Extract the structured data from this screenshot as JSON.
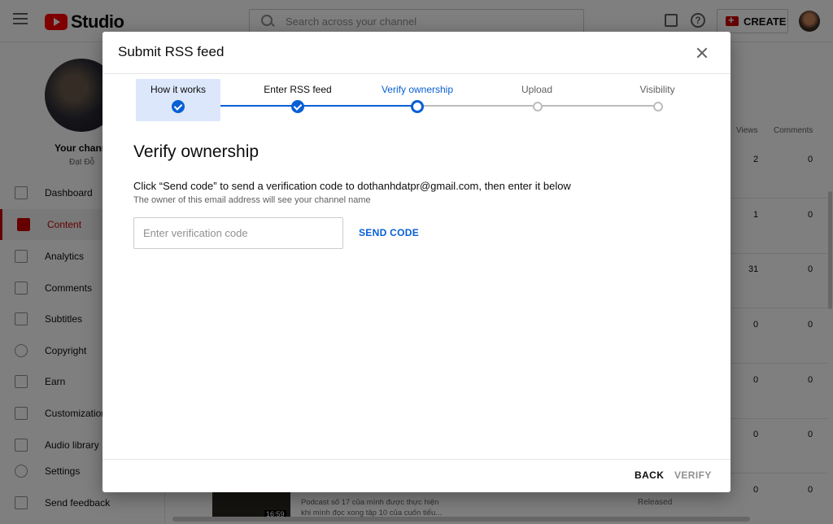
{
  "app": {
    "logo_text": "Studio"
  },
  "search": {
    "placeholder": "Search across your channel"
  },
  "header": {
    "create_label": "CREATE",
    "help_glyph": "?"
  },
  "sidebar": {
    "channel_label": "Your channel",
    "channel_name": "Đạt Đỗ",
    "items": [
      {
        "label": "Dashboard",
        "icon": "dashboard-icon"
      },
      {
        "label": "Content",
        "icon": "content-icon",
        "active": true
      },
      {
        "label": "Analytics",
        "icon": "analytics-icon"
      },
      {
        "label": "Comments",
        "icon": "comments-icon"
      },
      {
        "label": "Subtitles",
        "icon": "subtitles-icon"
      },
      {
        "label": "Copyright",
        "icon": "copyright-icon"
      },
      {
        "label": "Earn",
        "icon": "earn-icon"
      },
      {
        "label": "Customization",
        "icon": "customization-icon"
      },
      {
        "label": "Audio library",
        "icon": "audio-library-icon"
      },
      {
        "label": "Settings",
        "icon": "settings-icon"
      },
      {
        "label": "Send feedback",
        "icon": "send-feedback-icon"
      }
    ]
  },
  "table": {
    "headers": {
      "views": "Views",
      "comments": "Comments"
    },
    "rows": [
      {
        "views": "2",
        "comments": "0"
      },
      {
        "views": "1",
        "comments": "0"
      },
      {
        "views": "31",
        "comments": "0"
      },
      {
        "views": "0",
        "comments": "0"
      },
      {
        "views": "0",
        "comments": "0"
      },
      {
        "views": "0",
        "comments": "0"
      },
      {
        "views": "0",
        "comments": "0"
      }
    ],
    "last_row": {
      "duration": "16:59",
      "desc_line1": "Podcast số 17 của mình được thực hiện",
      "desc_line2": "khi mình đọc xong tập 10 của cuốn tiểu...",
      "status": "Released"
    }
  },
  "dialog": {
    "title": "Submit RSS feed",
    "steps": [
      {
        "label": "How it works",
        "state": "done"
      },
      {
        "label": "Enter RSS feed",
        "state": "done"
      },
      {
        "label": "Verify ownership",
        "state": "current"
      },
      {
        "label": "Upload",
        "state": "pending"
      },
      {
        "label": "Visibility",
        "state": "pending"
      }
    ],
    "section_title": "Verify ownership",
    "instruction": "Click “Send code” to send a verification code to dothanhdatpr@gmail.com, then enter it below",
    "subtext": "The owner of this email address will see your channel name",
    "code_input": {
      "placeholder": "Enter verification code",
      "value": ""
    },
    "send_code_label": "SEND CODE",
    "back_label": "BACK",
    "verify_label": "VERIFY"
  },
  "colors": {
    "accent": "#065fd4",
    "brand_red": "#cc0000",
    "highlight": "#dce7fb"
  }
}
